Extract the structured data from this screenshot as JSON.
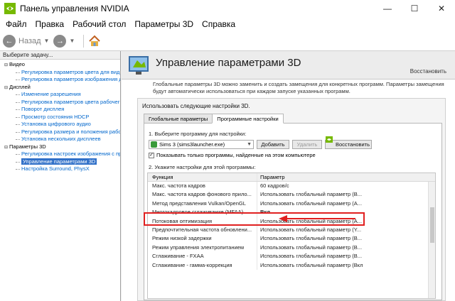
{
  "window": {
    "title": "Панель управления NVIDIA"
  },
  "menu": [
    "Файл",
    "Правка",
    "Рабочий стол",
    "Параметры 3D",
    "Справка"
  ],
  "toolbar": {
    "back_label": "Назад"
  },
  "sidebar": {
    "header": "Выберите задачу...",
    "tree": [
      {
        "type": "cat",
        "label": "Видео"
      },
      {
        "type": "leaf",
        "label": "Регулировка параметров цвета для вид"
      },
      {
        "type": "leaf",
        "label": "Регулировка параметров изображения д"
      },
      {
        "type": "cat",
        "label": "Дисплей"
      },
      {
        "type": "leaf",
        "label": "Изменение разрешения"
      },
      {
        "type": "leaf",
        "label": "Регулировка параметров цвета рабочег"
      },
      {
        "type": "leaf",
        "label": "Поворот дисплея"
      },
      {
        "type": "leaf",
        "label": "Просмотр состояния HDCP"
      },
      {
        "type": "leaf",
        "label": "Установка цифрового аудио"
      },
      {
        "type": "leaf",
        "label": "Регулировка размера и положения рабо"
      },
      {
        "type": "leaf",
        "label": "Установка нескольких дисплеев"
      },
      {
        "type": "cat",
        "label": "Параметры 3D"
      },
      {
        "type": "leaf",
        "label": "Регулировка настроек изображения с пр"
      },
      {
        "type": "leaf",
        "label": "Управление параметрами 3D",
        "selected": true
      },
      {
        "type": "leaf",
        "label": "Настройка Surround, PhysX"
      }
    ]
  },
  "main": {
    "title": "Управление параметрами 3D",
    "restore": "Восстановить",
    "desc1": "Глобальные параметры 3D можно заменить и создать замещения для конкретных программ. Параметры замещения",
    "desc2": "будут автоматически использоваться при каждом запуске указанных программ.",
    "panel_title": "Использовать следующие настройки 3D.",
    "tabs": [
      "Глобальные параметры",
      "Программные настройки"
    ],
    "step1": "1. Выберите программу для настройки:",
    "program": "Sims 3 (sims3launcher.exe)",
    "add_btn": "Добавить",
    "delete_btn": "Удалить",
    "restore_btn": "Восстановить",
    "show_only": "Показывать только программы, найденные на этом компьютере",
    "step2": "2. Укажите настройки для этой программы:",
    "col_function": "Функция",
    "col_param": "Параметр",
    "rows": [
      {
        "f": "Макс. частота кадров",
        "p": "60 кадров/с"
      },
      {
        "f": "Макс. частота кадров фонового прило...",
        "p": "Использовать глобальный параметр (В..."
      },
      {
        "f": "Метод представления Vulkan/OpenGL",
        "p": "Использовать глобальный параметр (А..."
      },
      {
        "f": "Многокадровое сглаживание (MFAA)",
        "p": "Вкл.",
        "hl": true
      },
      {
        "f": "Потоковая оптимизация",
        "p": "Использовать глобальный параметр (А..."
      },
      {
        "f": "Предпочтительная частота обновлени...",
        "p": "Использовать глобальный параметр (Y..."
      },
      {
        "f": "Режим низкой задержки",
        "p": "Использовать глобальный параметр (В..."
      },
      {
        "f": "Режим управления электропитанием",
        "p": "Использовать глобальный параметр (В..."
      },
      {
        "f": "Сглаживание - FXAA",
        "p": "Использовать глобальный параметр (В..."
      },
      {
        "f": "Сглаживание - гамма-коррекция",
        "p": "Использовать глобальный параметр (Вкл)"
      }
    ]
  },
  "colors": {
    "nvidia_green": "#76b900",
    "highlight_red": "#e02020",
    "selection_blue": "#3070c8"
  }
}
